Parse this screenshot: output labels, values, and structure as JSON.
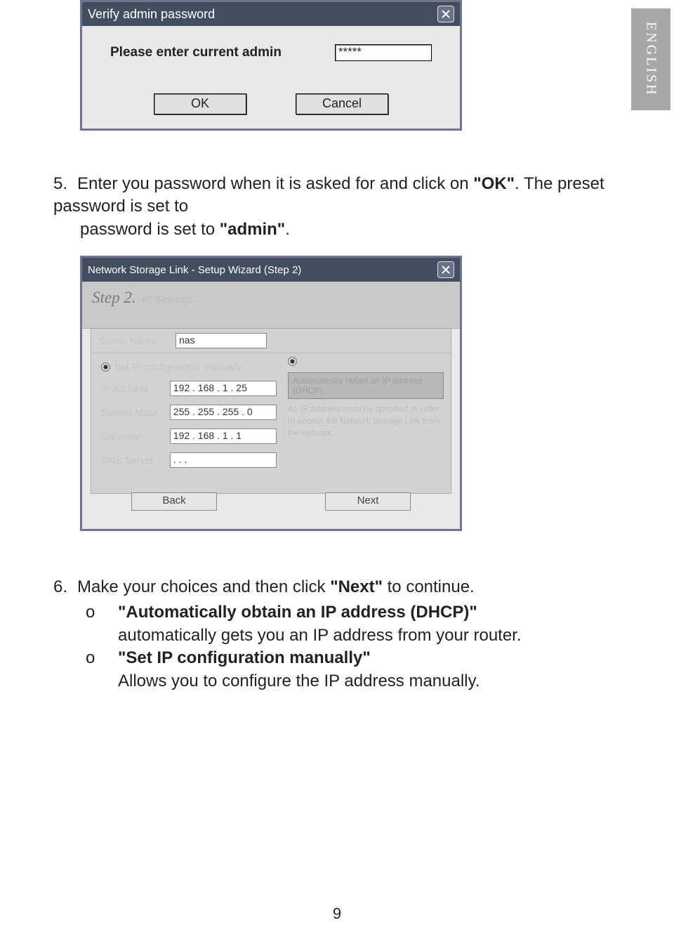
{
  "lang_tab": "ENGLISH",
  "page_number": "9",
  "dialog1": {
    "title": "Verify admin password",
    "prompt": "Please enter current admin",
    "password_value": "*****",
    "ok": "OK",
    "cancel": "Cancel"
  },
  "step5": {
    "num": "5.",
    "text_a": "Enter you password when it is asked for and click on ",
    "ok_quoted": "\"OK\"",
    "text_b": ". The preset password is set to ",
    "admin_quoted": "\"admin\"",
    "text_c": "."
  },
  "dialog2": {
    "title": "Network Storage Link - Setup Wizard (Step 2)",
    "step_label": "Step 2.",
    "step_sub": "IP Settings",
    "server_name_label": "Server Name",
    "server_name_value": "nas",
    "manual_label": "Set IP configuration manually",
    "ip_label": "IP Address",
    "ip_value": "192 . 168 .   1   . 25",
    "mask_label": "Subnet Mask",
    "mask_value": "255 . 255 . 255 .  0",
    "gw_label": "Gateway",
    "gw_value": "192 . 168 .   1   .  1",
    "dns_label": "DNS Server",
    "dns_value": ".        .        .",
    "dhcp_label": "Automatically obtain an IP address (DHCP)",
    "note": "An IP address must be specified in order to access the Network Storage Link from the network.",
    "back": "Back",
    "next": "Next"
  },
  "step6": {
    "num": "6.",
    "text_a": "Make your choices and then click ",
    "next_quoted": "\"Next\"",
    "text_b": " to continue.",
    "bullet": "o",
    "i1_bold": "\"Automatically obtain an IP address (DHCP)\"",
    "i1_rest": "automatically gets you an IP address from your router.",
    "i2_bold": "\"Set IP configuration manually\"",
    "i2_rest": "Allows you to configure the IP address manually."
  }
}
